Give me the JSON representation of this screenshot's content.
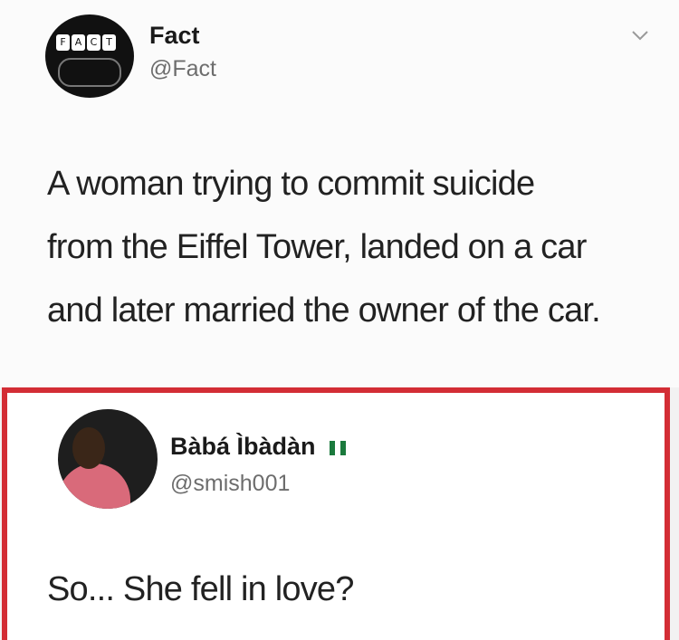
{
  "tweet": {
    "author_name": "Fact",
    "author_handle": "@Fact",
    "avatar_letters": [
      "F",
      "A",
      "C",
      "T"
    ],
    "text_lines": [
      "A woman trying to commit suicide",
      "from the Eiffel Tower, landed on a car",
      "and later married the owner of the car."
    ]
  },
  "reply": {
    "author_name": "Bàbá Ìbàdàn",
    "author_handle": "@smish001",
    "flag_icon": "nigeria-flag-icon",
    "text": "So... She fell in love?"
  },
  "colors": {
    "highlight_border": "#d32d35",
    "handle_gray": "#6d6d6d",
    "flag_green": "#1b7a3d"
  }
}
